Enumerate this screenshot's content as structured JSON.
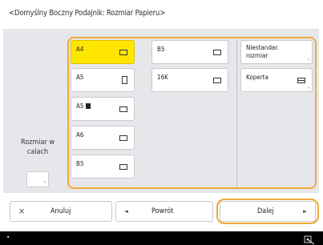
{
  "header": {
    "title": "<Domyślny Boczny Podajnik: Rozmiar Papieru>"
  },
  "left": {
    "label_line1": "Rozmiar w",
    "label_line2": "calach",
    "button_corner": "›"
  },
  "paper_buttons": [
    {
      "label": "A4",
      "icon": "landscape-paper-icon",
      "selected": true
    },
    {
      "label": "B5",
      "icon": "landscape-paper-icon",
      "selected": false
    },
    {
      "label": "A5",
      "icon": "portrait-paper-icon",
      "selected": false
    },
    {
      "label": "16K",
      "icon": "landscape-paper-icon",
      "selected": false
    },
    {
      "label": "A5",
      "icon": "landscape-paper-icon",
      "selected": false
    },
    {
      "label": "A6",
      "icon": "landscape-paper-icon",
      "selected": false
    },
    {
      "label": "B5",
      "icon": "landscape-paper-icon",
      "selected": false
    }
  ],
  "right_col": {
    "custom_line1": "Niestandar.",
    "custom_line2": "rozmiar",
    "envelope": "Koperta",
    "corner": "›"
  },
  "footer": {
    "cancel_icon": "×",
    "cancel": "Anuluj",
    "back_icon": "◄",
    "back": "Powrót",
    "next": "Dalej",
    "next_icon": "►"
  },
  "status": {
    "left_glyph": "•"
  },
  "colors": {
    "accent": "#f2a83a",
    "selected": "#ffe600",
    "panel": "#e6e7ea",
    "status_bar": "#000000"
  }
}
